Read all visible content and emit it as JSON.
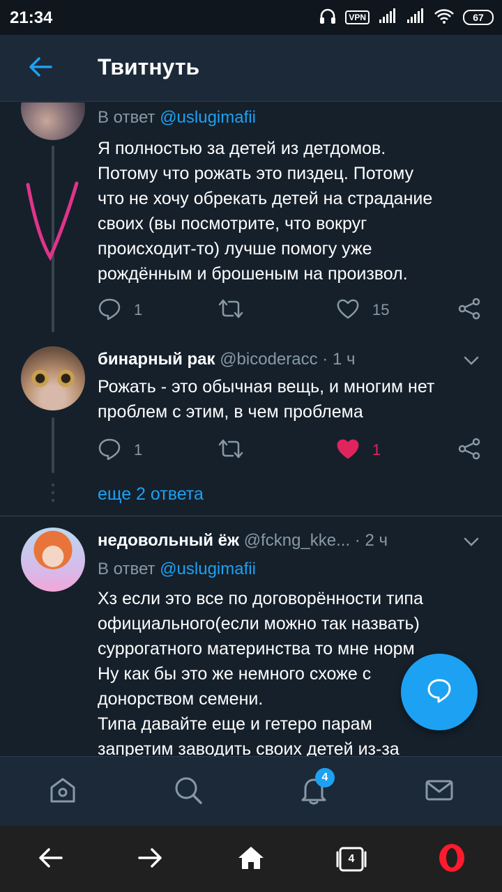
{
  "status_bar": {
    "time": "21:34",
    "vpn": "VPN",
    "battery": "67",
    "icons": [
      "headphones-icon",
      "signal-icon",
      "signal-icon",
      "wifi-icon",
      "battery-icon"
    ]
  },
  "header": {
    "title": "Твитнуть",
    "back_icon": "arrow-left-icon"
  },
  "tweets": [
    {
      "reply_prefix": "В ответ",
      "reply_handle": "@uslugimafii",
      "text": "Я полностью за детей из детдомов.\nПотому что рожать это пиздец. Потому\nчто не хочу обрекать детей на страдание\nсвоих (вы посмотрите, что вокруг\nпроисходит-то) лучше помогу уже\nрождённым и брошеным на произвол.",
      "replies": "1",
      "retweets": "",
      "likes": "15",
      "liked": false
    },
    {
      "name": "бинарный рак",
      "handle": "@bicoderacc",
      "time": "· 1 ч",
      "text": "Рожать - это обычная вещь, и многим нет\nпроблем с этим, в чем проблема",
      "replies": "1",
      "retweets": "",
      "likes": "1",
      "liked": true
    },
    {
      "name": "недовольный ёж",
      "handle": "@fckng_kke...",
      "time": "· 2 ч",
      "reply_prefix": "В ответ",
      "reply_handle": "@uslugimafii",
      "text": "Хз если это все по договорённости типа\nофициального(если можно так назвать)\nсуррогатного материнства то мне норм\nНу как бы это же немного схоже с\nдонорством семени.\nТипа давайте еще и гетеро парам\nзапретим заводить своих детей из-за"
    }
  ],
  "more_replies": "еще 2 ответа",
  "tab_bar": {
    "items": [
      "home-icon",
      "search-icon",
      "notifications-icon",
      "messages-icon"
    ],
    "notifications_badge": "4"
  },
  "browser_nav": {
    "tabs_count": "4",
    "items": [
      "back-icon",
      "forward-icon",
      "home-icon",
      "tabs-icon",
      "opera-icon"
    ]
  },
  "colors": {
    "background": "#15202b",
    "header": "#1c2938",
    "accent": "#1da1f2",
    "like": "#e0245e",
    "muted": "#8899a6",
    "annotation": "#e0348a"
  }
}
